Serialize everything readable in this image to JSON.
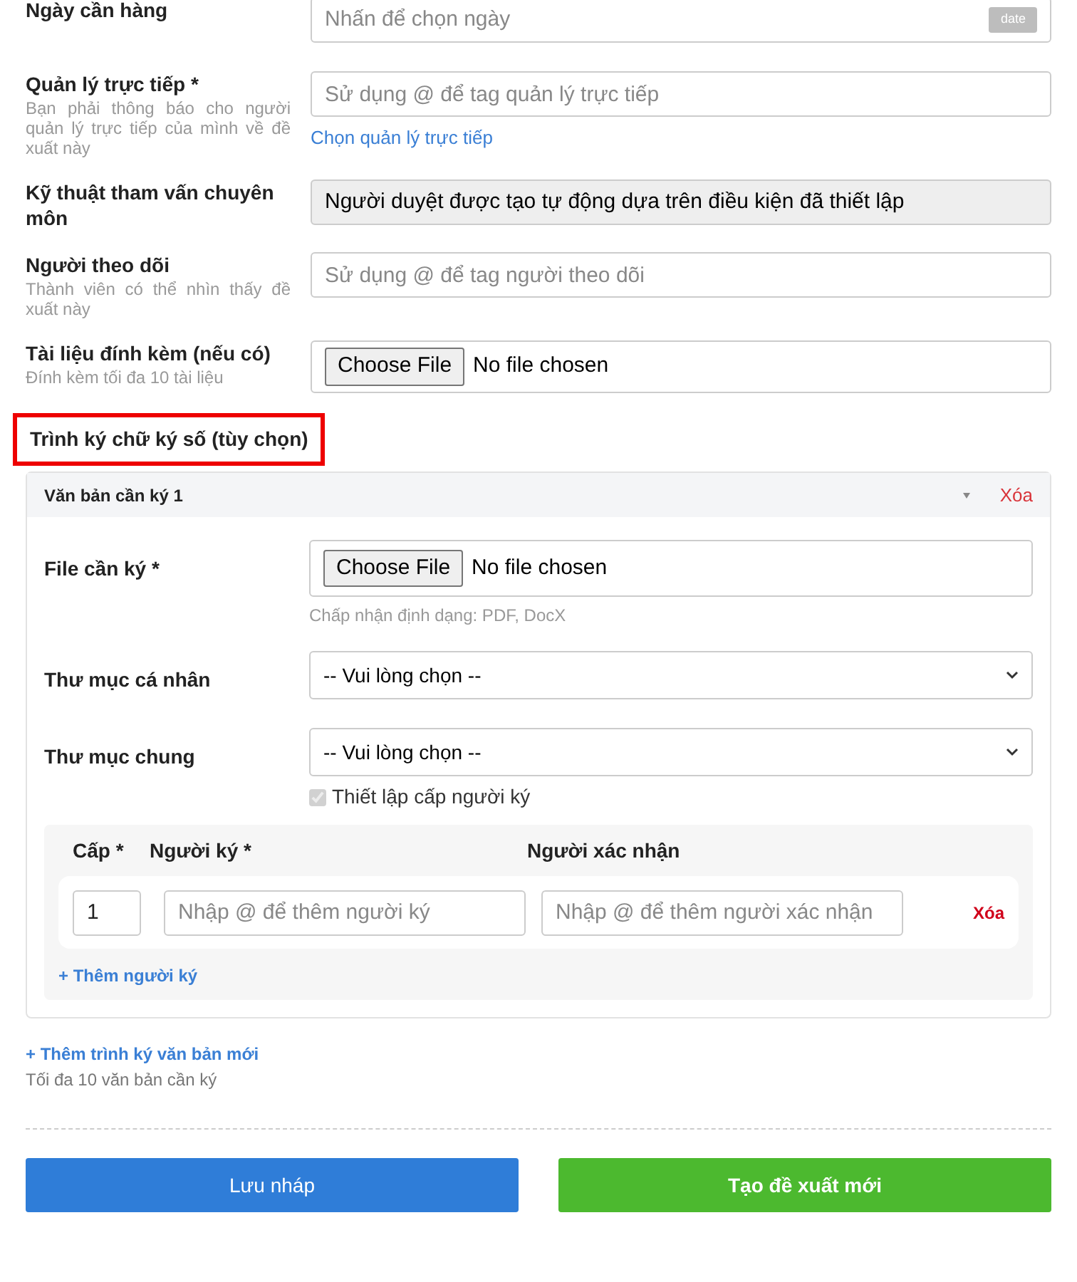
{
  "fields": [
    {
      "kind": "date",
      "label": "Ngày cần hàng",
      "placeholder": "Nhấn để chọn ngày",
      "badge": "date"
    },
    {
      "kind": "text",
      "label": "Quản lý trực tiếp *",
      "hint": "Bạn phải thông báo cho người quản lý trực tiếp của mình về đề xuất này",
      "placeholder": "Sử dụng @ để tag quản lý trực tiếp",
      "link": "Chọn quản lý trực tiếp"
    },
    {
      "kind": "readonly",
      "label": "Kỹ thuật tham vấn chuyên môn",
      "value": "Người duyệt được tạo tự động dựa trên điều kiện đã thiết lập"
    },
    {
      "kind": "text",
      "label": "Người theo dõi",
      "hint": "Thành viên có thể nhìn thấy đề xuất này",
      "placeholder": "Sử dụng @ để tag người theo dõi"
    },
    {
      "kind": "file",
      "label": "Tài liệu đính kèm (nếu có)",
      "hint": "Đính kèm tối đa 10 tài liệu",
      "button": "Choose File",
      "status": "No file chosen"
    }
  ],
  "signing": {
    "title": "Trình ký chữ ký số (tùy chọn)",
    "highlighted": true,
    "documents": [
      {
        "title": "Văn bản cần ký 1",
        "delete": "Xóa",
        "fields": [
          {
            "kind": "file",
            "label": "File cần ký *",
            "button": "Choose File",
            "status": "No file chosen",
            "hint": "Chấp nhận định dạng: PDF, DocX"
          },
          {
            "kind": "select",
            "label": "Thư mục cá nhân",
            "value": "-- Vui lòng chọn --"
          },
          {
            "kind": "select",
            "label": "Thư mục chung",
            "value": "-- Vui lòng chọn --"
          }
        ],
        "checkbox": {
          "label": "Thiết lập cấp người ký",
          "checked": true,
          "disabled": true
        },
        "signer_table": {
          "columns": [
            "Cấp *",
            "Người ký *",
            "Người xác nhận"
          ],
          "rows": [
            {
              "level": "1",
              "signer_placeholder": "Nhập @ để thêm người ký",
              "confirmer_placeholder": "Nhập @ để thêm người xác nhận",
              "delete": "Xóa"
            }
          ],
          "add_link": "+ Thêm người ký"
        }
      }
    ],
    "add_link": "+ Thêm trình ký văn bản mới",
    "note": "Tối đa 10 văn bản cần ký"
  },
  "buttons": [
    {
      "label": "Lưu nháp",
      "kind": "draft"
    },
    {
      "label": "Tạo đề xuất mới",
      "kind": "submit"
    }
  ]
}
